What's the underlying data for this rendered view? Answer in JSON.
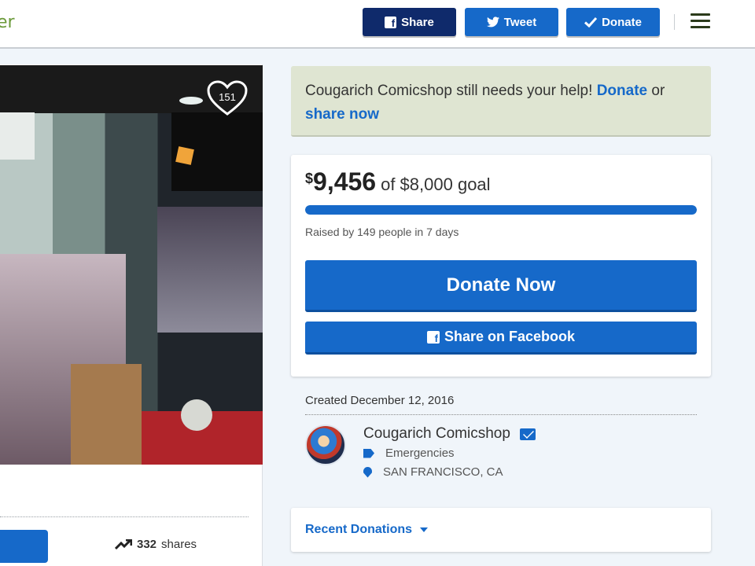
{
  "header": {
    "brand_fragment": "er",
    "share_label": "Share",
    "tweet_label": "Tweet",
    "donate_label": "Donate",
    "menu_icon": "hamburger-icon"
  },
  "campaign": {
    "heart_count": "151",
    "shares_count": "332",
    "shares_label": "shares"
  },
  "alert": {
    "text": "Cougarich Comicshop still needs your help!",
    "donate_link": "Donate",
    "or": "or",
    "share_link": "share now"
  },
  "goal": {
    "currency": "$",
    "raised": "9,456",
    "goal_text": "of $8,000 goal",
    "progress_fraction": 1.0,
    "raised_by": "Raised by 149 people in 7 days",
    "donate_now_label": "Donate Now",
    "share_fb_label": "Share on Facebook"
  },
  "organizer": {
    "created": "Created December 12, 2016",
    "name": "Cougarich Comicshop",
    "category": "Emergencies",
    "location": "SAN FRANCISCO, CA"
  },
  "recent": {
    "label": "Recent Donations"
  },
  "colors": {
    "primary": "#1669c9",
    "dark_navy": "#0f2a6b",
    "alert_bg": "#dfe5d2"
  }
}
